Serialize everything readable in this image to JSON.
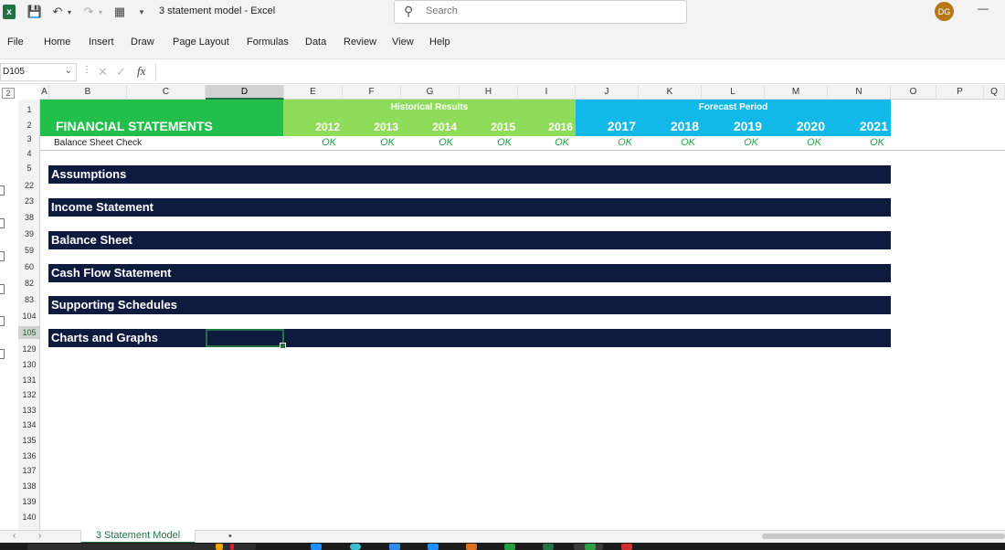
{
  "app": {
    "title": "3 statement model  -  Excel",
    "search_placeholder": "Search",
    "user_initials": "DG"
  },
  "ribbon": {
    "tabs": [
      "File",
      "Home",
      "Insert",
      "Draw",
      "Page Layout",
      "Formulas",
      "Data",
      "Review",
      "View",
      "Help"
    ]
  },
  "formula_bar": {
    "name_box": "D105",
    "fx_label": "fx",
    "formula": ""
  },
  "grid": {
    "outline_level": "2",
    "columns": [
      "A",
      "B",
      "C",
      "D",
      "E",
      "F",
      "G",
      "H",
      "I",
      "J",
      "K",
      "L",
      "M",
      "N",
      "O",
      "P",
      "Q"
    ],
    "selected_column": "D",
    "rows": [
      "1",
      "2",
      "3",
      "4",
      "5",
      "22",
      "23",
      "38",
      "39",
      "59",
      "60",
      "82",
      "83",
      "104",
      "105",
      "129",
      "130",
      "131",
      "132",
      "133",
      "134",
      "135",
      "136",
      "137",
      "138",
      "139",
      "140"
    ],
    "selected_row": "105"
  },
  "sheet": {
    "title": "FINANCIAL STATEMENTS",
    "historical_label": "Historical Results",
    "forecast_label": "Forecast Period",
    "historical_years": [
      "2012",
      "2013",
      "2014",
      "2015",
      "2016"
    ],
    "forecast_years": [
      "2017",
      "2018",
      "2019",
      "2020",
      "2021"
    ],
    "check_label": "Balance Sheet Check",
    "check_values": [
      "OK",
      "OK",
      "OK",
      "OK",
      "OK",
      "OK",
      "OK",
      "OK",
      "OK",
      "OK"
    ],
    "sections": [
      "Assumptions",
      "Income Statement",
      "Balance Sheet",
      "Cash Flow Statement",
      "Supporting Schedules",
      "Charts and Graphs"
    ],
    "colors": {
      "title_bg": "#22bf4d",
      "historical_bg": "#8fdc5a",
      "forecast_bg": "#12b8e8",
      "section_bg": "#0f1a3f",
      "ok_text": "#22a64a"
    }
  },
  "sheet_tabs": {
    "active": "3 Statement Model"
  }
}
